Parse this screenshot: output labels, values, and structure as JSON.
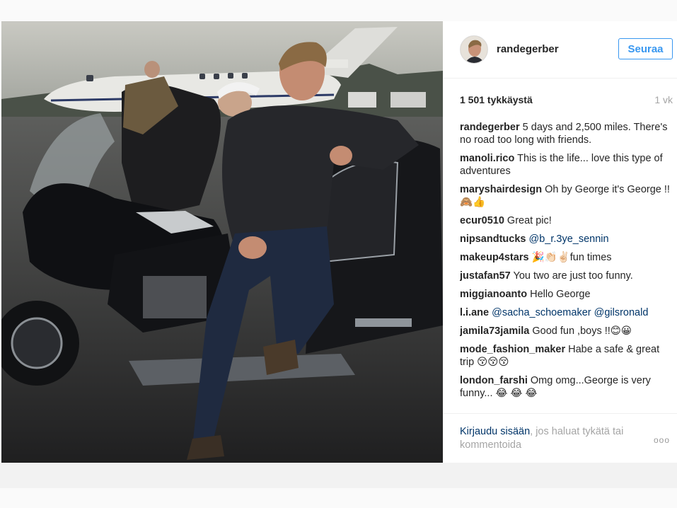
{
  "post": {
    "username": "randegerber",
    "follow_label": "Seuraa",
    "likes": "1 501 tykkäystä",
    "age": "1 vk"
  },
  "comments": [
    {
      "user": "randegerber",
      "text": "5 days and 2,500 miles. There's no road too long with friends."
    },
    {
      "user": "manoli.rico",
      "text": "This is the life... love this type of adventures"
    },
    {
      "user": "maryshairdesign",
      "text": "Oh by George it's George !! 🙈👍"
    },
    {
      "user": "ecur0510",
      "text": "Great pic!"
    },
    {
      "user": "nipsandtucks",
      "text": "",
      "mention": "@b_r.3ye_sennin"
    },
    {
      "user": "makeup4stars",
      "text": "🎉👏🏻✌🏻fun times"
    },
    {
      "user": "justafan57",
      "text": "You two are just too funny."
    },
    {
      "user": "miggianoanto",
      "text": "Hello George"
    },
    {
      "user": "l.i.ane",
      "text": "",
      "mention": "@sacha_schoemaker @gilsronald"
    },
    {
      "user": "jamila73jamila",
      "text": "Good fun ,boys !!😊😀"
    },
    {
      "user": "mode_fashion_maker",
      "text": "Habe a safe & great trip 😚😚😚"
    },
    {
      "user": "london_farshi",
      "text": "Omg omg...George is very funny... 😂 😂 😂"
    }
  ],
  "footer": {
    "login_link": "Kirjaudu sisään",
    "login_rest": ", jos haluat tykätä tai kommentoida",
    "more": "ooo"
  },
  "colors": {
    "link": "#003569",
    "follow": "#3897f0",
    "muted": "#a5a5a5"
  },
  "icons": {
    "more": "more-options-icon"
  }
}
